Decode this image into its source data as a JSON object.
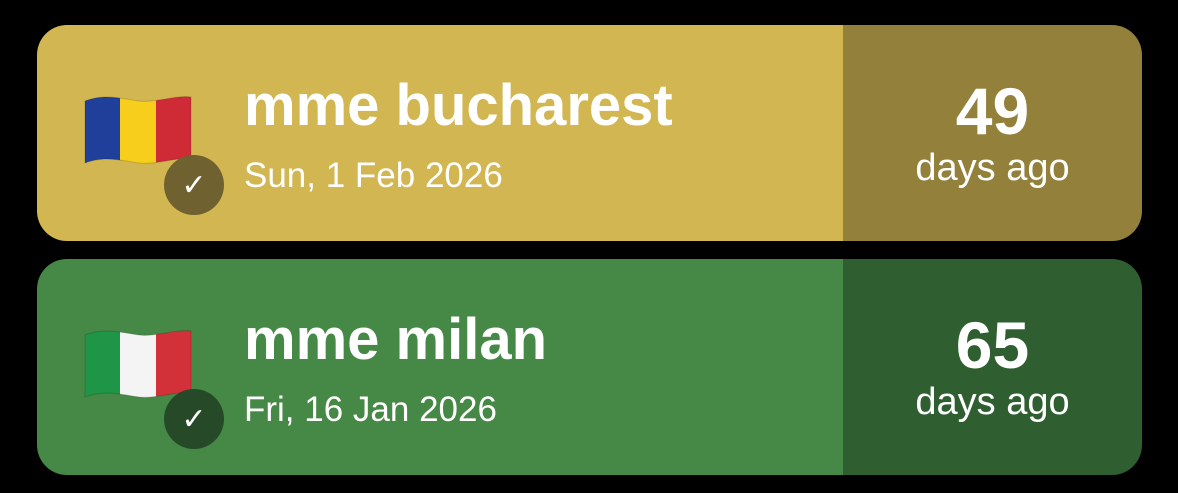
{
  "events": [
    {
      "title": "mme bucharest",
      "date": "Sun, 1 Feb 2026",
      "days": "49",
      "days_label": "days ago",
      "flag": "romania-flag",
      "status_icon": "check-icon",
      "colors": {
        "main": "#D2B652",
        "side": "#93813B",
        "badge": "#706130"
      }
    },
    {
      "title": "mme milan",
      "date": "Fri, 16 Jan 2026",
      "days": "65",
      "days_label": "days ago",
      "flag": "italy-flag",
      "status_icon": "check-icon",
      "colors": {
        "main": "#468846",
        "side": "#2F5E30",
        "badge": "#264A27"
      }
    }
  ]
}
